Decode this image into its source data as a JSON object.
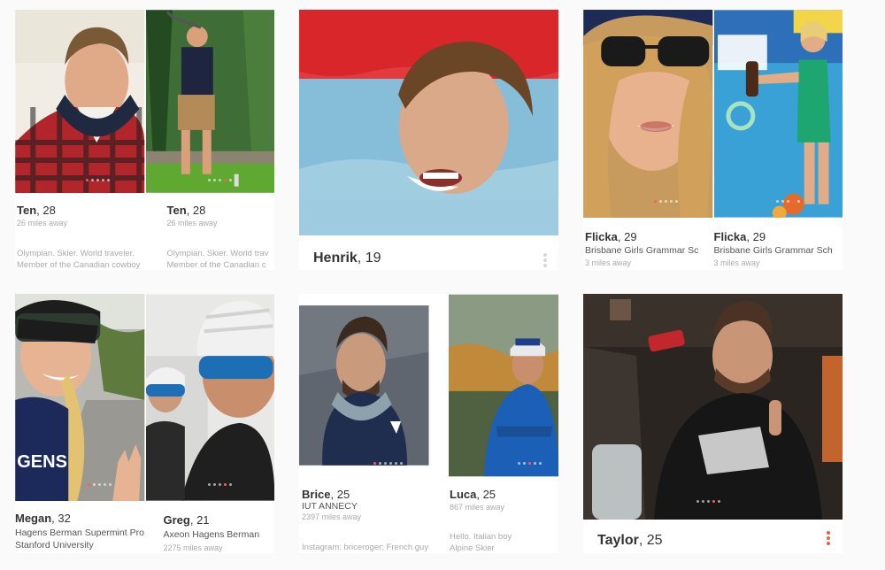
{
  "cards": [
    {
      "left": {
        "name": "Ten",
        "age": "28",
        "distance": "26 miles away",
        "bio1": "Olympian. Skier. World traveler.",
        "bio2": "Member of the Canadian cowboy"
      },
      "right": {
        "name": "Ten",
        "age": "28",
        "distance": "26 miles away",
        "bio1": "Olympian. Skier. World trav",
        "bio2": "Member of the Canadian c"
      }
    },
    {
      "single": {
        "name": "Henrik",
        "age": "19"
      }
    },
    {
      "left": {
        "name": "Flicka",
        "age": "29",
        "school": "Brisbane Girls Grammar Sc",
        "distance": "3 miles away"
      },
      "right": {
        "name": "Flicka",
        "age": "29",
        "school": "Brisbane Girls Grammar Sch",
        "distance": "3 miles away"
      }
    },
    {
      "left": {
        "name": "Megan",
        "age": "32",
        "work": "Hagens Berman Supermint Pro",
        "school": "Stanford University"
      },
      "right": {
        "name": "Greg",
        "age": "21",
        "work": "Axeon Hagens Berman",
        "distance": "2275 miles away"
      }
    },
    {
      "left": {
        "name": "Brice",
        "age": "25",
        "school": "IUT ANNECY",
        "distance": "2397 miles away",
        "bio": "Instagram: briceroger;   French guy"
      },
      "right": {
        "name": "Luca",
        "age": "25",
        "distance": "867 miles away",
        "bio1": "Hello. Italian boy",
        "bio2": "Alpine Skier"
      }
    },
    {
      "single": {
        "name": "Taylor",
        "age": "25"
      }
    }
  ],
  "colors": {
    "accent": "#ff5a5f",
    "kebab_muted": "#d6d6d6"
  }
}
